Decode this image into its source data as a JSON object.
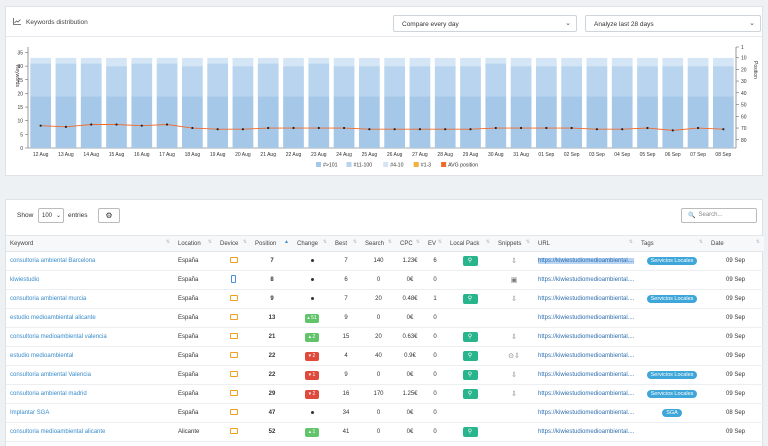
{
  "header": {
    "title": "Keywords distribution",
    "compare_select": "Compare every day",
    "period_select": "Analyze last 28 days"
  },
  "chart_data": {
    "type": "bar",
    "ylabel_left": "Keywords",
    "ylabel_right": "Position",
    "left_ticks": [
      0,
      5,
      10,
      15,
      20,
      25,
      30,
      35
    ],
    "right_ticks": [
      1,
      10,
      20,
      30,
      40,
      50,
      60,
      70,
      80
    ],
    "categories": [
      "12 Aug",
      "13 Aug",
      "14 Aug",
      "15 Aug",
      "16 Aug",
      "17 Aug",
      "18 Aug",
      "19 Aug",
      "20 Aug",
      "21 Aug",
      "22 Aug",
      "23 Aug",
      "24 Aug",
      "25 Aug",
      "26 Aug",
      "27 Aug",
      "28 Aug",
      "29 Aug",
      "30 Aug",
      "31 Aug",
      "01 Sep",
      "02 Sep",
      "03 Sep",
      "04 Sep",
      "05 Sep",
      "06 Sep",
      "07 Sep",
      "08 Sep"
    ],
    "series": [
      {
        "name": "#>101",
        "color": "#a6c8e8",
        "values": [
          19,
          19,
          19,
          19,
          19,
          19,
          19,
          19,
          19,
          19,
          19,
          19,
          19,
          19,
          19,
          19,
          19,
          19,
          19,
          19,
          19,
          19,
          19,
          19,
          19,
          19,
          19,
          19
        ]
      },
      {
        "name": "#11-100",
        "color": "#b8d4ee",
        "values": [
          12,
          12,
          12,
          11,
          12,
          12,
          11,
          12,
          11,
          12,
          11,
          12,
          11,
          11,
          11,
          11,
          11,
          11,
          12,
          11,
          11,
          11,
          11,
          11,
          11,
          11,
          11,
          11
        ]
      },
      {
        "name": "#4-10",
        "color": "#d4e6f6",
        "values": [
          2,
          2,
          2,
          3,
          2,
          2,
          3,
          2,
          3,
          2,
          3,
          2,
          3,
          3,
          3,
          3,
          3,
          3,
          2,
          3,
          3,
          3,
          3,
          3,
          3,
          3,
          3,
          3
        ]
      },
      {
        "name": "#1-3",
        "color": "#f5b040",
        "values": [
          0,
          0,
          0,
          0,
          0,
          0,
          0,
          0,
          0,
          0,
          0,
          0,
          0,
          0,
          0,
          0,
          0,
          0,
          0,
          0,
          0,
          0,
          0,
          0,
          0,
          0,
          0,
          0
        ]
      },
      {
        "name": "AVG position",
        "color": "#f06a2a",
        "type": "line",
        "values": [
          68,
          69,
          67,
          67,
          68,
          67,
          70,
          71,
          71,
          70,
          70,
          70,
          70,
          71,
          71,
          71,
          71,
          71,
          70,
          70,
          70,
          70,
          71,
          71,
          70,
          72,
          70,
          71
        ]
      }
    ],
    "ylim_left": [
      0,
      37
    ],
    "ylim_right": [
      1,
      87
    ]
  },
  "controls": {
    "show_label": "Show",
    "page_length": "100",
    "entries_label": "entries",
    "search_placeholder": "Search..."
  },
  "table": {
    "columns": [
      "Keyword",
      "Location",
      "Device",
      "Position",
      "Change",
      "Best",
      "Search",
      "CPC",
      "EV",
      "Local Pack",
      "Snippets",
      "URL",
      "Tags",
      "Date"
    ],
    "rows": [
      {
        "keyword": "consultoria ambiental Barcelona",
        "location": "España",
        "device": "desktop",
        "position": "7",
        "change": "",
        "best": "7",
        "search": "140",
        "cpc": "1.23€",
        "ev": "6",
        "local": true,
        "snip": "⇩",
        "url": "https://kiwiestudiomedioambiental....",
        "url_hl": true,
        "tag": "Servicios Locales",
        "date": "09 Sep"
      },
      {
        "keyword": "kiwiestudio",
        "location": "España",
        "device": "mobile",
        "position": "8",
        "change": "",
        "best": "6",
        "search": "0",
        "cpc": "0€",
        "ev": "0",
        "local": false,
        "snip": "▣",
        "url": "https://kiwiestudiomedioambiental....",
        "url_hl": false,
        "tag": "",
        "date": "09 Sep"
      },
      {
        "keyword": "consultoria ambiental murcia",
        "location": "España",
        "device": "desktop",
        "position": "9",
        "change": "",
        "best": "7",
        "search": "20",
        "cpc": "0.48€",
        "ev": "1",
        "local": true,
        "snip": "⇩",
        "url": "https://kiwiestudiomedioambiental....",
        "url_hl": false,
        "tag": "Servicios Locales",
        "date": "09 Sep"
      },
      {
        "keyword": "estudio medioambiental alicante",
        "location": "España",
        "device": "desktop",
        "position": "13",
        "change": "51",
        "dir": "up",
        "best": "9",
        "search": "0",
        "cpc": "0€",
        "ev": "0",
        "local": false,
        "snip": "",
        "url": "https://kiwiestudiomedioambiental....",
        "url_hl": false,
        "tag": "",
        "date": "09 Sep"
      },
      {
        "keyword": "consultoria medioambiental valencia",
        "location": "España",
        "device": "desktop",
        "position": "21",
        "change": "2",
        "dir": "up",
        "best": "15",
        "search": "20",
        "cpc": "0.63€",
        "ev": "0",
        "local": true,
        "snip": "⇩",
        "url": "https://kiwiestudiomedioambiental....",
        "url_hl": false,
        "tag": "",
        "date": "09 Sep"
      },
      {
        "keyword": "estudio medioambiental",
        "location": "España",
        "device": "desktop",
        "position": "22",
        "change": "2",
        "dir": "dn",
        "best": "4",
        "search": "40",
        "cpc": "0.9€",
        "ev": "0",
        "local": true,
        "snip": "⊙⇩",
        "url": "https://kiwiestudiomedioambiental....",
        "url_hl": false,
        "tag": "",
        "date": "09 Sep"
      },
      {
        "keyword": "consultoria ambiental Valencia",
        "location": "España",
        "device": "desktop",
        "position": "22",
        "change": "1",
        "dir": "dn",
        "best": "9",
        "search": "0",
        "cpc": "0€",
        "ev": "0",
        "local": true,
        "snip": "⇩",
        "url": "https://kiwiestudiomedioambiental....",
        "url_hl": false,
        "tag": "Servicios Locales",
        "date": "09 Sep"
      },
      {
        "keyword": "consultoria ambiental madrid",
        "location": "España",
        "device": "desktop",
        "position": "29",
        "change": "2",
        "dir": "dn",
        "best": "16",
        "search": "170",
        "cpc": "1.25€",
        "ev": "0",
        "local": true,
        "snip": "⇩",
        "url": "https://kiwiestudiomedioambiental....",
        "url_hl": false,
        "tag": "Servicios Locales",
        "date": "09 Sep"
      },
      {
        "keyword": "Implantar SGA",
        "location": "España",
        "device": "desktop",
        "position": "47",
        "change": "",
        "best": "34",
        "search": "0",
        "cpc": "0€",
        "ev": "0",
        "local": false,
        "snip": "",
        "url": "https://kiwiestudiomedioambiental....",
        "url_hl": false,
        "tag": "SGA",
        "date": "08 Sep"
      },
      {
        "keyword": "consultoria medioambiental alicante",
        "location": "Alicante",
        "device": "desktop",
        "position": "52",
        "change": "1",
        "dir": "up",
        "best": "41",
        "search": "0",
        "cpc": "0€",
        "ev": "0",
        "local": true,
        "snip": "",
        "url": "https://kiwiestudiomedioambiental....",
        "url_hl": false,
        "tag": "",
        "date": "09 Sep"
      }
    ]
  }
}
